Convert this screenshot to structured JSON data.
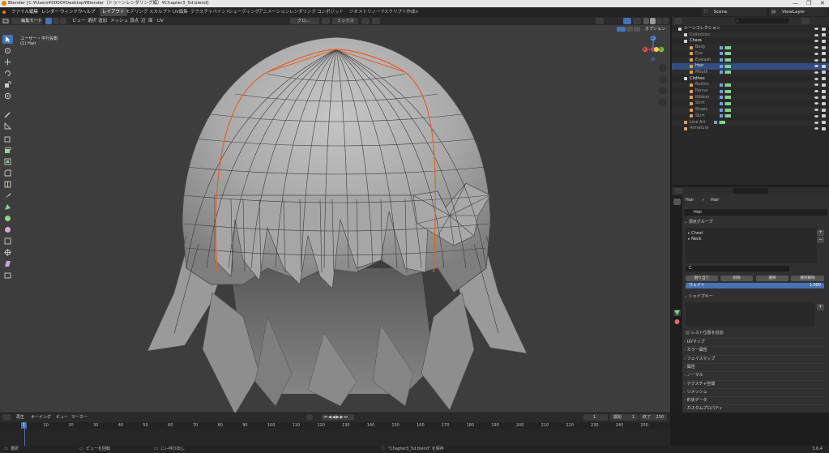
{
  "window": {
    "title": "Blender [C:¥Users¥0000¥Desktop¥Blender（トゥーンレンダリング編）¥Chapter3_5d.blend]",
    "controls": [
      "—",
      "❐",
      "✕"
    ]
  },
  "menu": {
    "items": [
      "ファイル",
      "編集",
      "レンダー",
      "ウィンドウ",
      "ヘルプ"
    ],
    "workspaces": [
      "レイアウト",
      "モデリング",
      "スカルプト",
      "UV編集",
      "テクスチャペイント",
      "シェーディング",
      "アニメーション",
      "レンダリング",
      "コンポジット",
      "ジオメトリノード",
      "スクリプト作成",
      "+"
    ],
    "active_workspace": "レイアウト",
    "scene": "Scene",
    "view_layer": "ViewLayer"
  },
  "viewport_header": {
    "mode": "編集モード",
    "menus": [
      "ビュー",
      "選択",
      "追加",
      "メッシュ",
      "頂点",
      "辺",
      "面",
      "UV"
    ],
    "transform_orientation": "グロ...",
    "pivot": "ミックス",
    "options": "オプション"
  },
  "viewport": {
    "overlay_title": "ユーザー・平行投影",
    "overlay_subtitle": "(1) Hair",
    "axis_labels": {
      "z": "Z",
      "x": "X",
      "y": "Y"
    },
    "tools": [
      "select-box",
      "cursor",
      "move",
      "rotate",
      "scale",
      "transform",
      "annotate",
      "measure",
      "add-cube",
      "extrude",
      "inset",
      "bevel",
      "loop-cut",
      "knife",
      "poly-build",
      "spin",
      "smooth",
      "edge-slide",
      "shrink-fatten",
      "shear",
      "rip-region"
    ]
  },
  "outliner": {
    "search_placeholder": "",
    "rows": [
      {
        "label": "シーンコレクション",
        "indent": 0,
        "kind": "scene-collection"
      },
      {
        "label": "Collection",
        "indent": 1,
        "kind": "collection",
        "dim": true
      },
      {
        "label": "Chara",
        "indent": 1,
        "kind": "collection"
      },
      {
        "label": "Body",
        "indent": 2,
        "kind": "object",
        "dim": true
      },
      {
        "label": "Eye",
        "indent": 2,
        "kind": "object",
        "dim": true
      },
      {
        "label": "Eyelash",
        "indent": 2,
        "kind": "object",
        "dim": true
      },
      {
        "label": "Hair",
        "indent": 2,
        "kind": "object",
        "selected": true
      },
      {
        "label": "Mouth",
        "indent": 2,
        "kind": "object",
        "dim": true
      },
      {
        "label": "Clothes",
        "indent": 1,
        "kind": "collection"
      },
      {
        "label": "Button",
        "indent": 2,
        "kind": "object",
        "dim": true
      },
      {
        "label": "Penna",
        "indent": 2,
        "kind": "object",
        "dim": true
      },
      {
        "label": "Ribbon",
        "indent": 2,
        "kind": "object",
        "dim": true
      },
      {
        "label": "Shirt",
        "indent": 2,
        "kind": "object",
        "dim": true
      },
      {
        "label": "Shoes",
        "indent": 2,
        "kind": "object",
        "dim": true
      },
      {
        "label": "Skirt",
        "indent": 2,
        "kind": "object",
        "dim": true
      },
      {
        "label": "Line Art",
        "indent": 1,
        "kind": "object",
        "dim": true
      },
      {
        "label": "Armature",
        "indent": 1,
        "kind": "armature",
        "dim": true
      }
    ]
  },
  "properties": {
    "breadcrumb_object": "Hair",
    "breadcrumb_data": "Hair",
    "mesh_name": "Hair",
    "vertex_groups_header": "頂点グループ",
    "vertex_groups": [
      "Chest",
      "Neck"
    ],
    "vg_filter": "C",
    "buttons": [
      "割り当て",
      "削除",
      "選択",
      "選択解除"
    ],
    "weight_label": "ウェイト",
    "weight_value": "1.000",
    "shape_keys_header": "シェイプキー",
    "rest_position_label": "レスト位置を追加",
    "collapsed_panels": [
      "UVマップ",
      "カラー属性",
      "フェイスマップ",
      "属性",
      "ノーマル",
      "テクスチャ空間",
      "リメッシュ",
      "形状データ",
      "カスタムプロパティ"
    ]
  },
  "timeline": {
    "menus": [
      "再生",
      "キーイング",
      "ビュー",
      "マーカー"
    ],
    "current_frame": "1",
    "start_label": "開始",
    "start": "1",
    "end_label": "終了",
    "end": "250",
    "ruler": [
      "1",
      "10",
      "20",
      "30",
      "40",
      "50",
      "60",
      "70",
      "80",
      "90",
      "100",
      "110",
      "120",
      "130",
      "140",
      "150",
      "160",
      "170",
      "180",
      "190",
      "200",
      "210",
      "220",
      "230",
      "240",
      "250"
    ],
    "playhead_label": "1"
  },
  "status": {
    "left": "選択",
    "middle": "ビューを回転",
    "middle2": "ｴﾆｭｰ呼び出し",
    "saved": "\"Chapter3_5d.blend\" を保存",
    "version": "3.6.4"
  },
  "colors": {
    "accent": "#4772b3",
    "seam": "#e0622a",
    "blender_orange": "#e87d0d",
    "mesh_green": "#7fd28a"
  }
}
